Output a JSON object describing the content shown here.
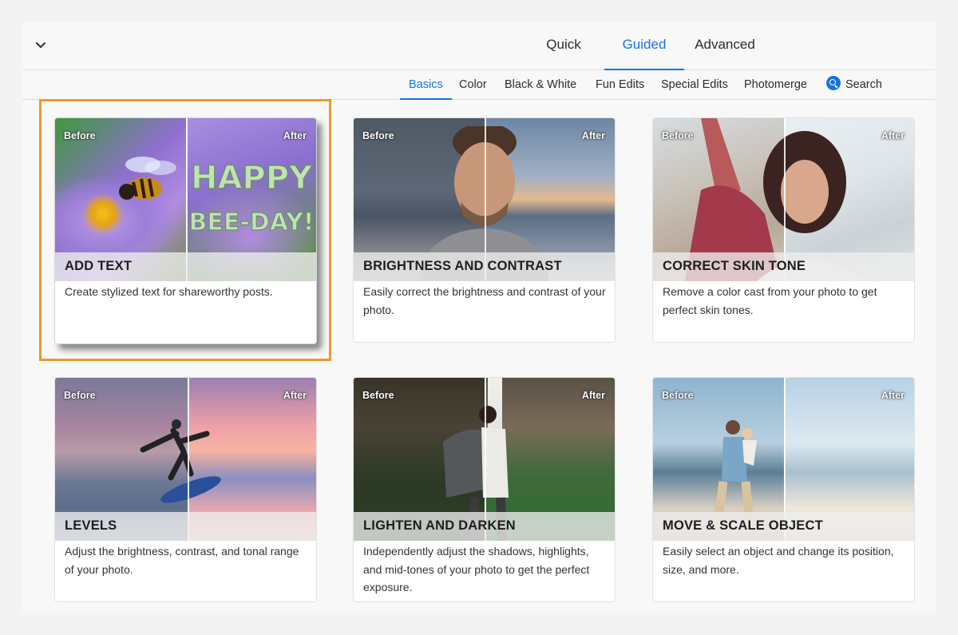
{
  "mode_tabs": {
    "quick": "Quick",
    "guided": "Guided",
    "advanced": "Advanced"
  },
  "sub_tabs": {
    "basics": "Basics",
    "color": "Color",
    "bw": "Black & White",
    "fun": "Fun Edits",
    "special": "Special Edits",
    "photomerge": "Photomerge",
    "search": "Search"
  },
  "labels": {
    "before": "Before",
    "after": "After"
  },
  "colors": {
    "accent": "#1473e6",
    "highlight": "#eb9a2c"
  },
  "cards": [
    {
      "title": "ADD TEXT",
      "desc": "Create stylized text for shareworthy posts.",
      "after_text_1": "HAPPY",
      "after_text_2": "BEE-DAY!"
    },
    {
      "title": "BRIGHTNESS AND CONTRAST",
      "desc": "Easily correct the brightness and contrast of your photo."
    },
    {
      "title": "CORRECT SKIN TONE",
      "desc": "Remove a color cast from your photo to get perfect skin tones."
    },
    {
      "title": "LEVELS",
      "desc": "Adjust the brightness, contrast, and tonal range of your photo."
    },
    {
      "title": "LIGHTEN AND DARKEN",
      "desc": "Independently adjust the shadows, highlights, and mid-tones of your photo to get the perfect exposure."
    },
    {
      "title": "MOVE & SCALE OBJECT",
      "desc": "Easily select an object and change its position, size, and more."
    }
  ]
}
